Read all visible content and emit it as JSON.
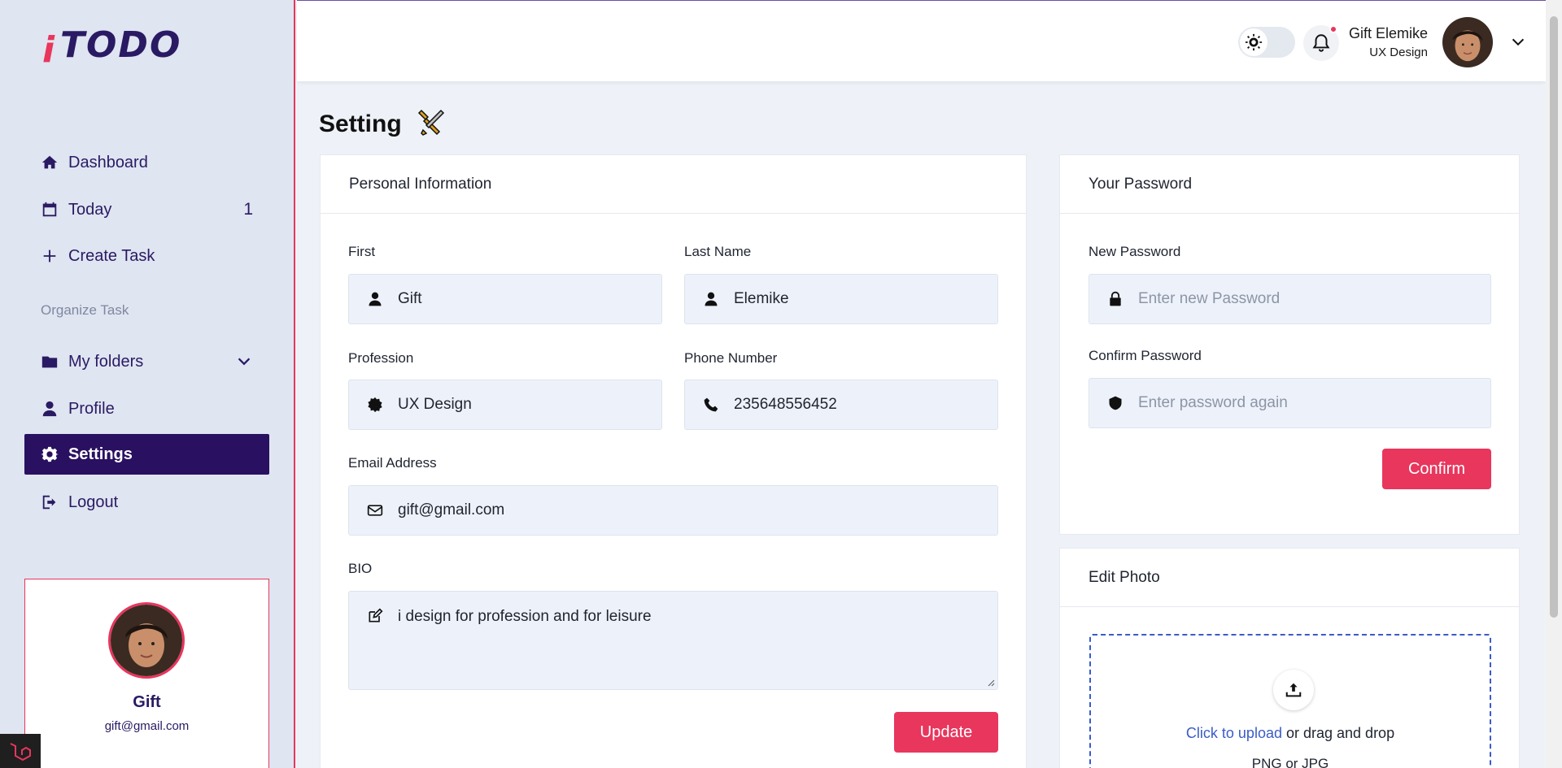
{
  "app": {
    "logo_i": "i",
    "logo_text": "TODO"
  },
  "sidebar": {
    "items": [
      {
        "label": "Dashboard",
        "icon": "home-icon"
      },
      {
        "label": "Today",
        "icon": "calendar-icon",
        "count": "1"
      },
      {
        "label": "Create Task",
        "icon": "plus-icon"
      },
      {
        "label": "My folders",
        "icon": "folder-icon"
      },
      {
        "label": "Profile",
        "icon": "user-icon"
      },
      {
        "label": "Settings",
        "icon": "gear-icon"
      },
      {
        "label": "Logout",
        "icon": "logout-icon"
      }
    ],
    "section_label": "Organize Task",
    "profile": {
      "name": "Gift",
      "email": "gift@gmail.com"
    }
  },
  "header": {
    "user_name": "Gift Elemike",
    "user_role": "UX Design",
    "notification_dot": true
  },
  "page": {
    "title": "Setting"
  },
  "personal": {
    "heading": "Personal Information",
    "first_label": "First",
    "first_value": "Gift",
    "last_label": "Last Name",
    "last_value": "Elemike",
    "profession_label": "Profession",
    "profession_value": "UX Design",
    "phone_label": "Phone Number",
    "phone_value": "235648556452",
    "email_label": "Email Address",
    "email_value": "gift@gmail.com",
    "bio_label": "BIO",
    "bio_value": "i design for profession and for leisure",
    "update_button": "Update"
  },
  "password": {
    "heading": "Your Password",
    "new_label": "New Password",
    "new_placeholder": "Enter new Password",
    "confirm_label": "Confirm Password",
    "confirm_placeholder": "Enter password again",
    "confirm_button": "Confirm"
  },
  "photo": {
    "heading": "Edit Photo",
    "upload_link": "Click to upload",
    "upload_rest": " or drag and drop",
    "upload_types": "PNG or JPG"
  },
  "colors": {
    "accent": "#e8365d",
    "brand": "#2a1060",
    "link": "#3a5cc7"
  }
}
